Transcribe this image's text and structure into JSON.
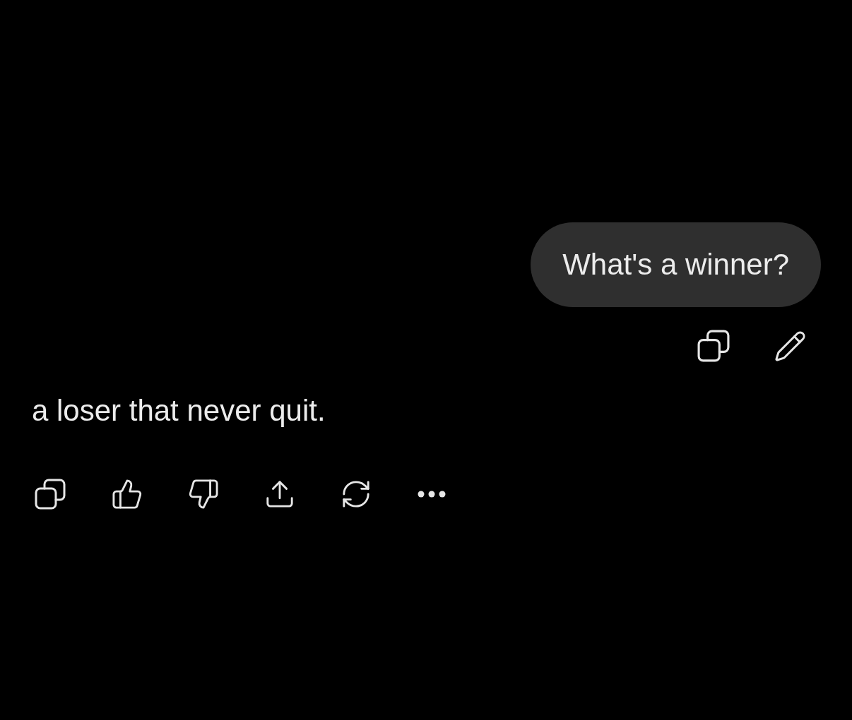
{
  "user_message": {
    "text": "What's a winner?"
  },
  "assistant_message": {
    "text": "a loser that never quit."
  }
}
